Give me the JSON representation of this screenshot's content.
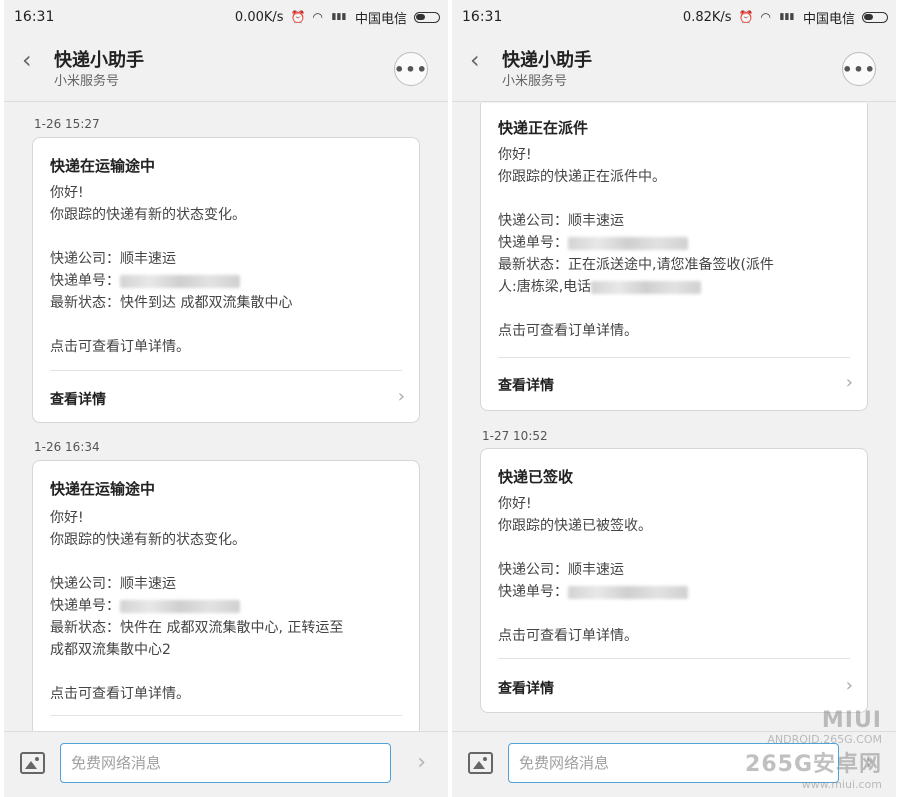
{
  "status_left": {
    "time": "16:31",
    "speed": "0.00K/s",
    "signal": "4G\n1X",
    "carrier": "中国电信"
  },
  "status_right": {
    "time": "16:31",
    "speed": "0.82K/s",
    "signal": "4G\n1X",
    "carrier": "中国电信"
  },
  "header": {
    "title": "快递小助手",
    "subtitle": "小米服务号",
    "more": "•••"
  },
  "input": {
    "placeholder": "免费网络消息"
  },
  "left": {
    "msg1": {
      "timestamp": "1-26 15:27",
      "title": "快递在运输途中",
      "greeting": "你好!",
      "intro": "你跟踪的快递有新的状态变化。",
      "company": "快递公司：顺丰速运",
      "tracking_label": "快递单号：",
      "status": "最新状态：快件到达 成都双流集散中心",
      "hint": "点击可查看订单详情。",
      "detail": "查看详情"
    },
    "msg2": {
      "timestamp": "1-26 16:34",
      "title": "快递在运输途中",
      "greeting": "你好!",
      "intro": "你跟踪的快递有新的状态变化。",
      "company": "快递公司：顺丰速运",
      "tracking_label": "快递单号：",
      "status1": "最新状态：快件在 成都双流集散中心, 正转运至",
      "status2": "成都双流集散中心2",
      "hint": "点击可查看订单详情。"
    }
  },
  "right": {
    "msg1": {
      "title": "快递正在派件",
      "greeting": "你好!",
      "intro": "你跟踪的快递正在派件中。",
      "company": "快递公司：顺丰速运",
      "tracking_label": "快递单号：",
      "status1": "最新状态：正在派送途中,请您准备签收(派件",
      "status2": "人:唐栋梁,电话",
      "hint": "点击可查看订单详情。",
      "detail": "查看详情"
    },
    "msg2": {
      "timestamp": "1-27 10:52",
      "title": "快递已签收",
      "greeting": "你好!",
      "intro": "你跟踪的快递已被签收。",
      "company": "快递公司：顺丰速运",
      "tracking_label": "快递单号：",
      "hint": "点击可查看订单详情。",
      "detail": "查看详情"
    }
  },
  "watermark": {
    "line1": "ANDROID.265G.COM",
    "line2": "265G安卓网",
    "line3": "www.miui.com",
    "brand": "MIUI"
  }
}
